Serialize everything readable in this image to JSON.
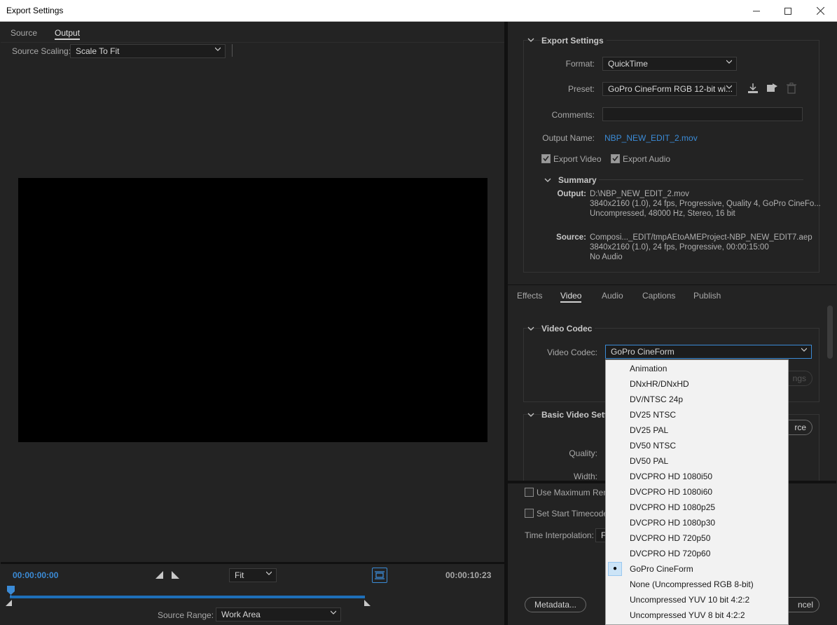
{
  "window": {
    "title": "Export Settings"
  },
  "left": {
    "tabs": [
      {
        "label": "Source"
      },
      {
        "label": "Output"
      }
    ],
    "source_scaling_label": "Source Scaling:",
    "source_scaling_value": "Scale To Fit",
    "timeline": {
      "current_time": "00:00:00:00",
      "end_time": "00:00:10:23",
      "zoom_value": "Fit",
      "source_range_label": "Source Range:",
      "source_range_value": "Work Area",
      "in_point": 0.0,
      "out_point": 1.0
    }
  },
  "export_settings": {
    "section_title": "Export Settings",
    "format_label": "Format:",
    "format_value": "QuickTime",
    "preset_label": "Preset:",
    "preset_value": "GoPro CineForm RGB 12-bit wi...",
    "comments_label": "Comments:",
    "comments_value": "",
    "output_name_label": "Output Name:",
    "output_name_value": "NBP_NEW_EDIT_2.mov",
    "export_video_label": "Export Video",
    "export_video_checked": true,
    "export_audio_label": "Export Audio",
    "export_audio_checked": true,
    "summary": {
      "title": "Summary",
      "output_label": "Output:",
      "output_lines": [
        "D:\\NBP_NEW_EDIT_2.mov",
        "3840x2160 (1.0), 24 fps, Progressive, Quality 4, GoPro CineFo...",
        "Uncompressed, 48000 Hz, Stereo, 16 bit"
      ],
      "source_label": "Source:",
      "source_lines": [
        "Composi..._EDIT/tmpAEtoAMEProject-NBP_NEW_EDIT7.aep",
        "3840x2160 (1.0), 24 fps, Progressive, 00:00:15:00",
        "No Audio"
      ]
    }
  },
  "settings_tabs": [
    {
      "label": "Effects"
    },
    {
      "label": "Video"
    },
    {
      "label": "Audio"
    },
    {
      "label": "Captions"
    },
    {
      "label": "Publish"
    }
  ],
  "video_codec": {
    "section_title": "Video Codec",
    "codec_label": "Video Codec:",
    "codec_value": "GoPro CineForm",
    "codec_settings_partial": "ngs"
  },
  "basic_video": {
    "section_title": "Basic Video Settin",
    "match_source_partial": "rce",
    "quality_label": "Quality:",
    "width_label": "Width:"
  },
  "bottom": {
    "use_max_render_label": "Use Maximum Rend",
    "set_start_tc_label": "Set Start Timecode",
    "time_interp_label": "Time Interpolation:",
    "time_interp_partial": "F",
    "metadata_button": "Metadata...",
    "cancel_partial": "ncel"
  },
  "codec_options": [
    "Animation",
    "DNxHR/DNxHD",
    "DV/NTSC 24p",
    "DV25 NTSC",
    "DV25 PAL",
    "DV50 NTSC",
    "DV50 PAL",
    "DVCPRO HD 1080i50",
    "DVCPRO HD 1080i60",
    "DVCPRO HD 1080p25",
    "DVCPRO HD 1080p30",
    "DVCPRO HD 720p50",
    "DVCPRO HD 720p60",
    "GoPro CineForm",
    "None (Uncompressed RGB 8-bit)",
    "Uncompressed YUV 10 bit 4:2:2",
    "Uncompressed YUV 8 bit 4:2:2"
  ],
  "selected_codec_index": 13,
  "colors": {
    "accent": "#3b8bd6",
    "panel": "#232323",
    "list_bg": "#f2f2f2"
  }
}
